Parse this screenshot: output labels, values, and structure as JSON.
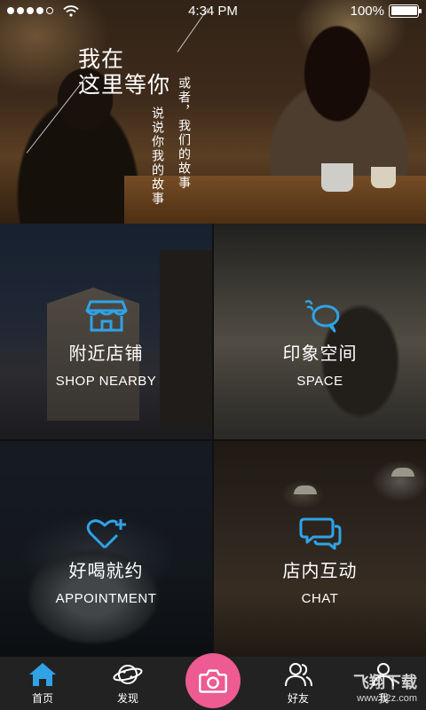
{
  "status_bar": {
    "time": "4:34 PM",
    "battery_text": "100%",
    "battery_level": 1.0,
    "signal_bars_filled": 4,
    "signal_bars_total": 5
  },
  "hero": {
    "title_line1": "我在",
    "title_line2": "这里等你",
    "vertical_text_1": "说说你我的故事",
    "vertical_text_2": "或者，我们的故事"
  },
  "tiles": [
    {
      "label_cn": "附近店铺",
      "label_en": "SHOP NEARBY",
      "icon": "store-icon"
    },
    {
      "label_cn": "印象空间",
      "label_en": "SPACE",
      "icon": "chat-bubble-icon"
    },
    {
      "label_cn": "好喝就约",
      "label_en": "APPOINTMENT",
      "icon": "heart-plus-icon"
    },
    {
      "label_cn": "店内互动",
      "label_en": "CHAT",
      "icon": "speech-bubbles-icon"
    }
  ],
  "tabbar": {
    "items": [
      {
        "label": "首页",
        "icon": "home-icon",
        "active": true
      },
      {
        "label": "发现",
        "icon": "planet-icon",
        "active": false
      },
      {
        "label": "",
        "icon": "camera-icon",
        "active": false
      },
      {
        "label": "好友",
        "icon": "friends-icon",
        "active": false
      },
      {
        "label": "我",
        "icon": "profile-icon",
        "active": false
      }
    ]
  },
  "colors": {
    "accent_blue": "#2fa3e6",
    "camera_pink": "#ee5a92",
    "tabbar_bg": "#222222"
  },
  "watermark": {
    "line1": "飞翔下载",
    "line2": "www.52z.com"
  }
}
